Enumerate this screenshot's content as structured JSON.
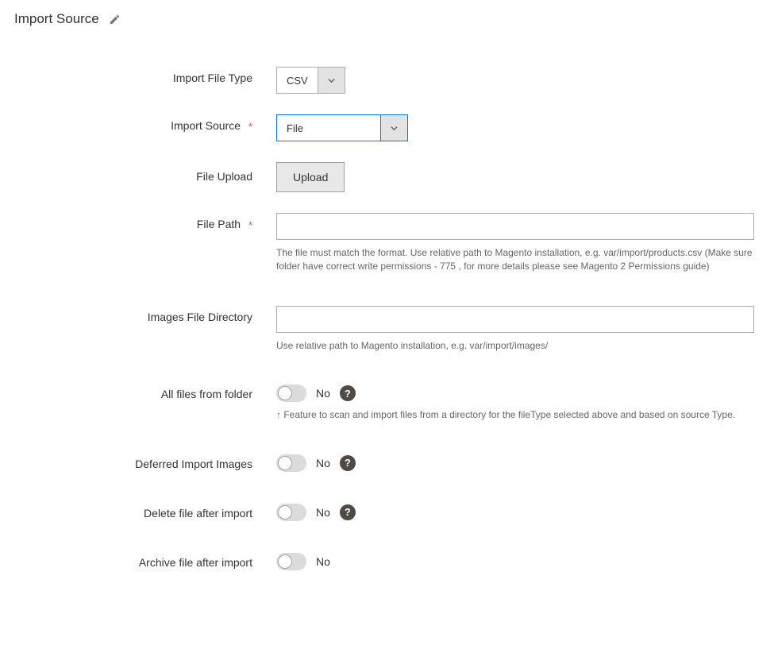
{
  "section": {
    "title": "Import Source"
  },
  "fields": {
    "import_file_type": {
      "label": "Import File Type",
      "value": "CSV"
    },
    "import_source": {
      "label": "Import Source",
      "required_marker": "*",
      "value": "File"
    },
    "file_upload": {
      "label": "File Upload",
      "button_label": "Upload"
    },
    "file_path": {
      "label": "File Path",
      "required_marker": "*",
      "value": "",
      "note": "The file must match the format. Use relative path to Magento installation, e.g. var/import/products.csv (Make sure folder have correct write permissions - 775 , for more details please see Magento 2 Permissions guide)"
    },
    "images_dir": {
      "label": "Images File Directory",
      "value": "",
      "note": "Use relative path to Magento installation, e.g. var/import/images/"
    },
    "all_files": {
      "label": "All files from folder",
      "state_label": "No",
      "note": "↑ Feature to scan and import files from a directory for the fileType selected above and based on source Type."
    },
    "deferred_images": {
      "label": "Deferred Import Images",
      "state_label": "No"
    },
    "delete_after": {
      "label": "Delete file after import",
      "state_label": "No"
    },
    "archive_after": {
      "label": "Archive file after import",
      "state_label": "No"
    }
  },
  "icons": {
    "help_glyph": "?"
  }
}
